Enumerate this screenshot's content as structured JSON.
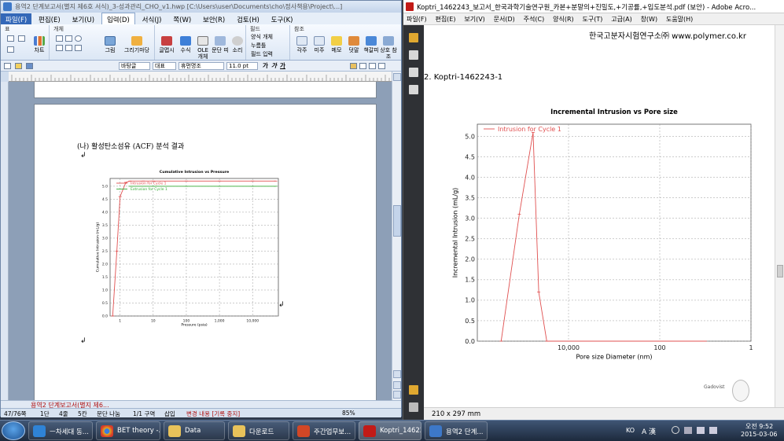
{
  "hwp": {
    "title": "용역2 단계보고서(별지 제6호 서식)_3-성과관리_CHO_v1.hwp [C:\\Users\\user\\Documents\\cho\\정사책용\\Project\\...]",
    "menu": [
      "파일(F)",
      "편집(E)",
      "보기(U)",
      "입력(D)",
      "서식(J)",
      "쪽(W)",
      "보안(R)",
      "검토(H)",
      "도구(K)"
    ],
    "ribbon": {
      "group_table": "표",
      "group_object": "개체",
      "group_field": "필드",
      "group_reference": "참조",
      "chart_label": "차트",
      "btn_picture": "그림",
      "btn_drawing": "그리기마당",
      "btn_glyph": "글맵시",
      "btn_formula": "수식",
      "btn_ole": "OLE 개체",
      "btn_paragraph": "문단 띠",
      "btn_sound": "소리",
      "field_form": "양식 개체",
      "field_click": "누름틀",
      "field_input": "필드 입력",
      "btn_footnote": "각주",
      "btn_endnote": "미주",
      "btn_memo": "메모",
      "btn_comment": "덧말",
      "btn_bookmark": "책갈피",
      "btn_crossref": "상호 참조"
    },
    "format": {
      "style": "바탕글",
      "lang": "대표",
      "font": "휴먼명조",
      "size": "11.0 pt"
    },
    "page": {
      "heading": "(나) 활성탄소섬유 (ACF) 분석 결과",
      "para_mark": "↲"
    },
    "doc_tab": "용역2 단계보고서(별지 제6...",
    "status": [
      "47/76쪽",
      "1단",
      "4줄",
      "5칸",
      "문단 나눔",
      "1/1 구역",
      "삽입",
      "변경 내용 [기록 중지]",
      "85%"
    ]
  },
  "pdf": {
    "title": "Koptri_1462243_보고서_한국과학기술연구원_카본+분말의+진밀도,+기공률,+입도분석.pdf (보안) - Adobe Acro...",
    "menu": [
      "파일(F)",
      "편집(E)",
      "보기(V)",
      "문서(D)",
      "주석(C)",
      "양식(R)",
      "도구(T)",
      "고급(A)",
      "창(W)",
      "도움말(H)"
    ],
    "header": "한국고분자시험연구소㈜  www.polymer.co.kr",
    "section": "2. Koptri-1462243-1",
    "page_size": "210 x 297 mm",
    "sticker": "Gadovist"
  },
  "chart_data": [
    {
      "type": "line",
      "title": "Incremental Intrusion vs Pore size",
      "xlabel": "Pore size Diameter (nm)",
      "ylabel": "Incremental Intrusion (mL/g)",
      "x_scale": "log-reversed",
      "xlim": [
        1000000,
        1
      ],
      "ylim": [
        0,
        5.3
      ],
      "x_ticks": [
        "10,000",
        "100",
        "1"
      ],
      "y_ticks": [
        "0.0",
        "0.5",
        "1.0",
        "1.5",
        "2.0",
        "2.5",
        "3.0",
        "3.5",
        "4.0",
        "4.5",
        "5.0"
      ],
      "legend": "top-left",
      "grid": true,
      "color": "#e05050",
      "series": [
        {
          "name": "Intrusion for Cycle 1",
          "x": [
            300000,
            120000,
            60000,
            45000,
            30000,
            10000,
            1000,
            100,
            10
          ],
          "y": [
            0.0,
            3.1,
            5.1,
            1.2,
            0.0,
            0.0,
            0.0,
            0.0,
            0.0
          ]
        }
      ]
    },
    {
      "type": "line",
      "title": "Cumulative Intrusion vs Pressure",
      "xlabel": "Pressure (psia)",
      "ylabel": "Cumulative Intrusion (mL/g)",
      "x_scale": "log",
      "xlim": [
        0.5,
        60000
      ],
      "ylim": [
        0,
        5.3
      ],
      "x_ticks": [
        "1",
        "10",
        "100",
        "1,000",
        "10,000"
      ],
      "y_ticks": [
        "0.0",
        "0.5",
        "1.0",
        "1.5",
        "2.0",
        "2.5",
        "3.0",
        "3.5",
        "4.0",
        "4.5",
        "5.0"
      ],
      "legend": "top-left",
      "grid": true,
      "series": [
        {
          "name": "Intrusion for Cycle 1",
          "color": "#e05050",
          "x": [
            0.6,
            0.8,
            1.0,
            1.5,
            2,
            5,
            10,
            100,
            1000,
            10000,
            50000
          ],
          "y": [
            0.0,
            2.5,
            4.6,
            5.15,
            5.2,
            5.2,
            5.2,
            5.2,
            5.2,
            5.2,
            5.2
          ]
        },
        {
          "name": "Extrusion for Cycle 1",
          "color": "#33aa33",
          "x": [
            50000,
            10000,
            1000,
            100,
            10,
            2
          ],
          "y": [
            5.0,
            5.0,
            5.0,
            5.0,
            5.0,
            5.0
          ]
        }
      ]
    }
  ],
  "taskbar": {
    "items": [
      "ㅡ차세대 동...",
      "BET theory -...",
      "Data",
      "다운로드",
      "주간업무보...",
      "Koptri_14622...",
      "용역2 단계..."
    ],
    "lang": "KO",
    "ime": "A 漢",
    "time": "오전 9:52",
    "date": "2015-03-06"
  }
}
